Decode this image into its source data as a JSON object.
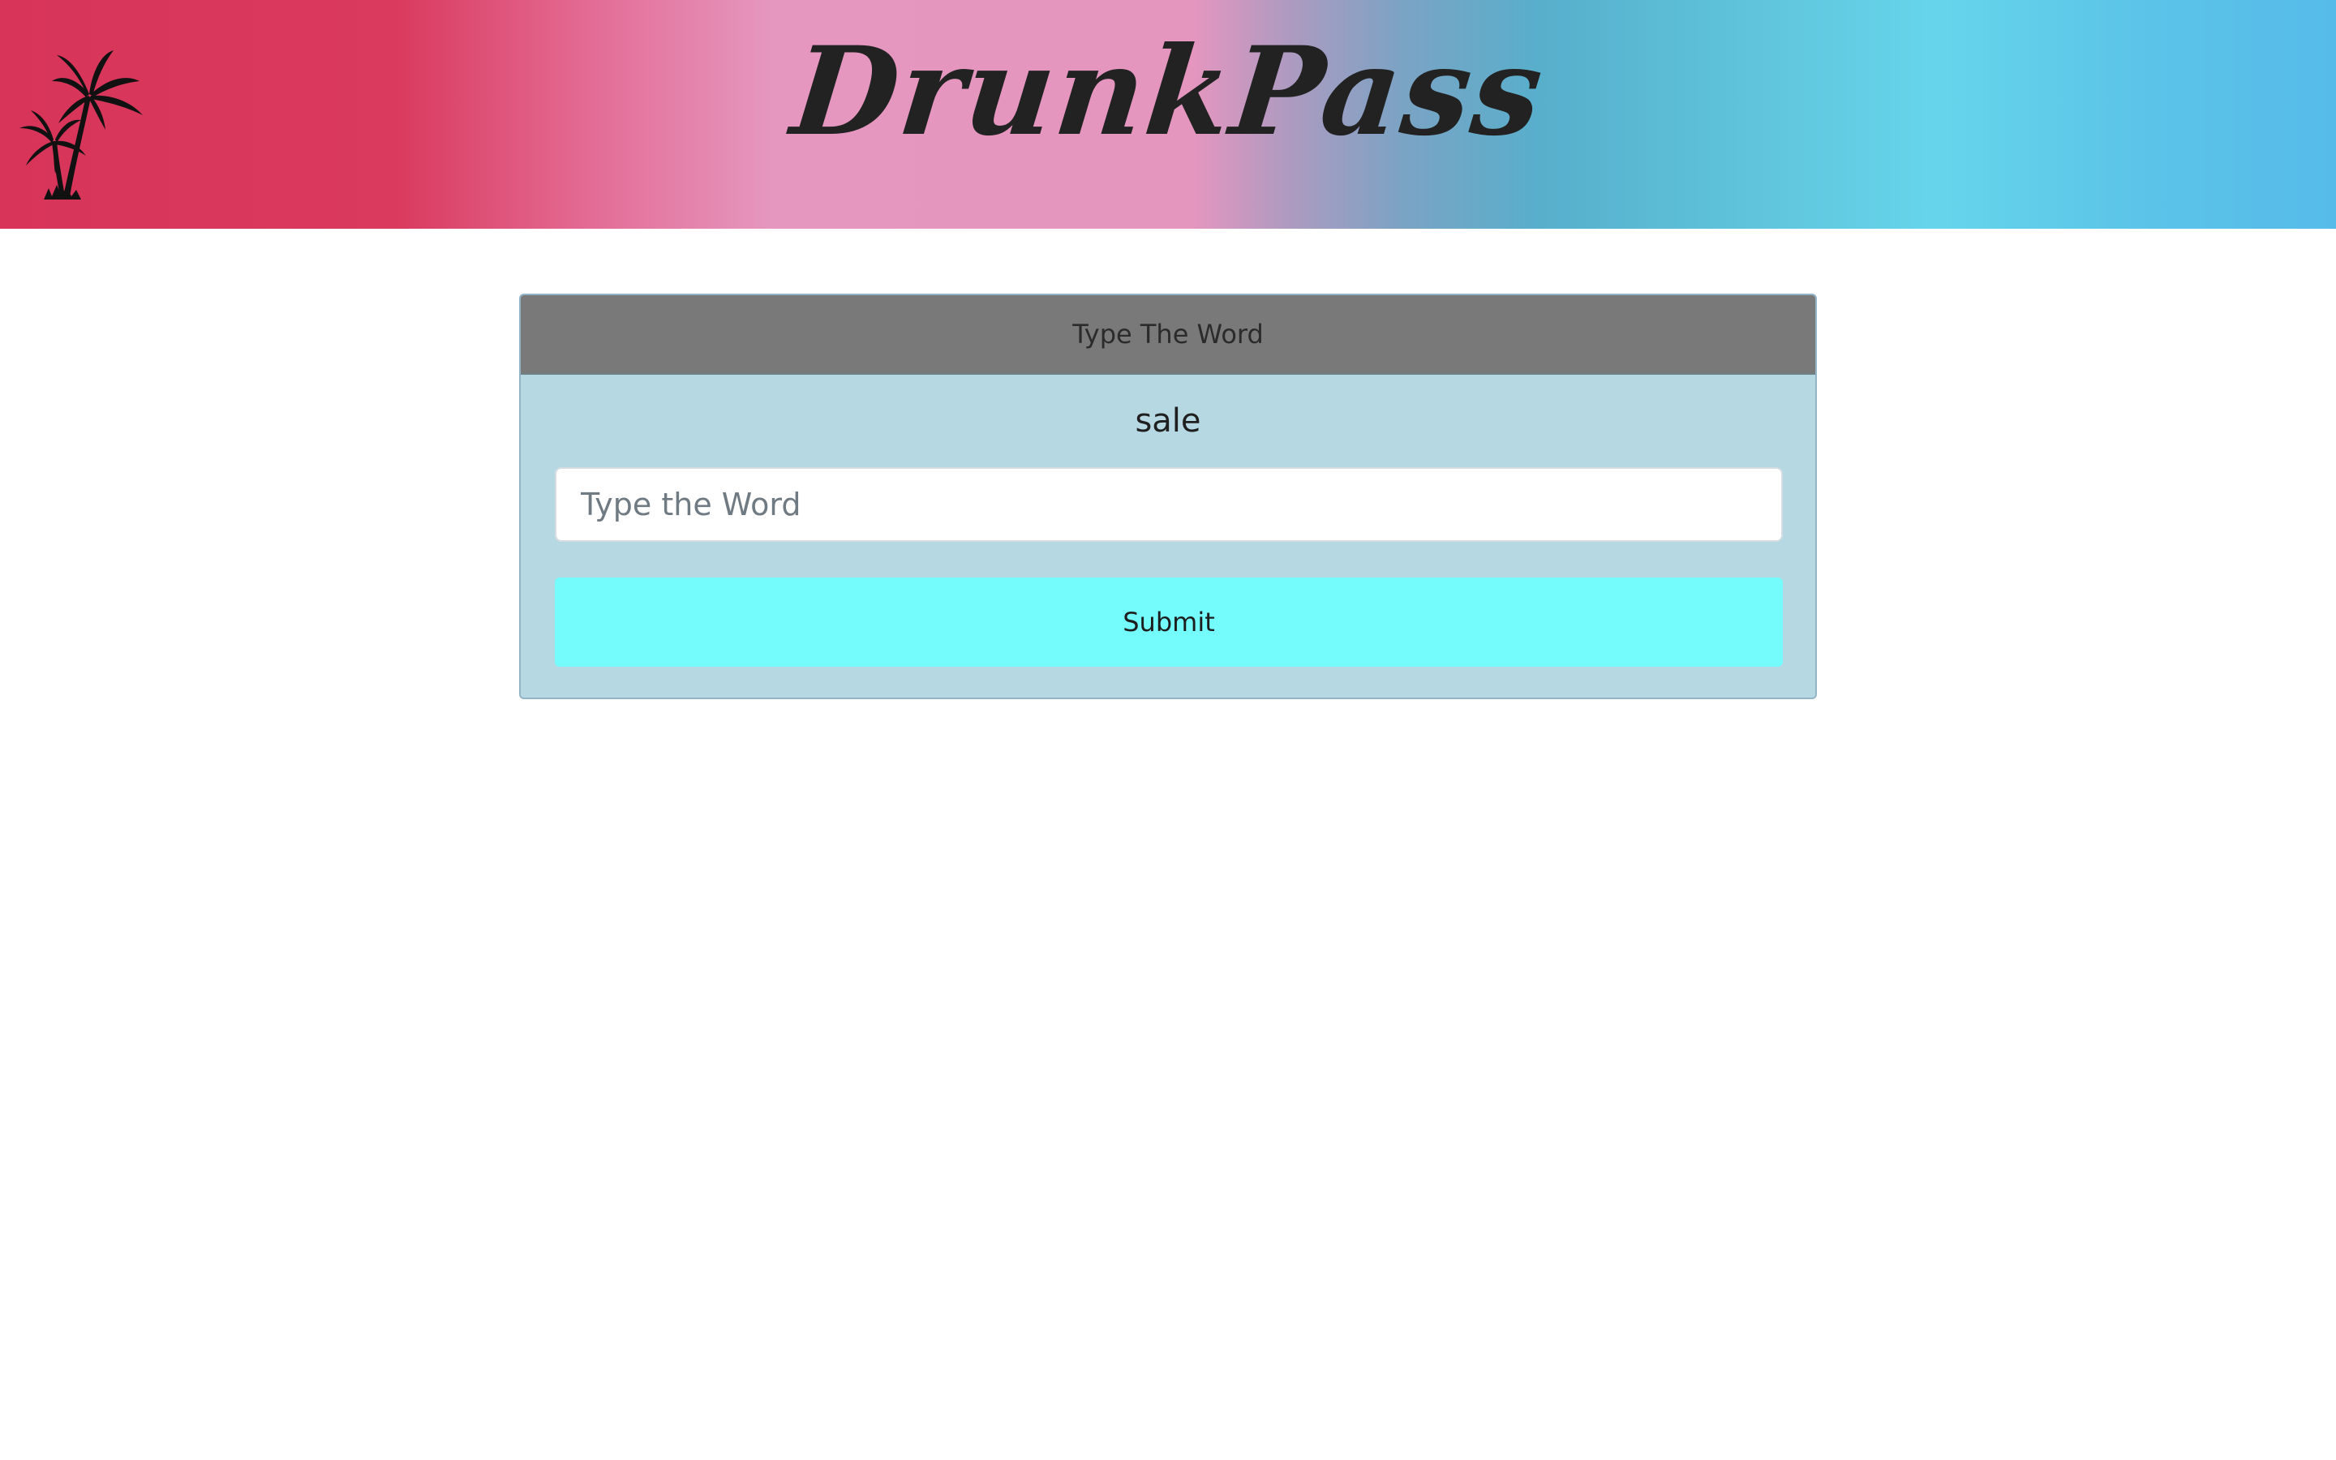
{
  "header": {
    "brand": "DrunkPass",
    "logo_icon": "palm-trees-icon"
  },
  "card": {
    "title": "Type The Word",
    "word": "sale",
    "input": {
      "value": "",
      "placeholder": "Type the Word"
    },
    "submit_label": "Submit"
  },
  "colors": {
    "banner_left": "#d8345a",
    "banner_middle": "#e596bf",
    "banner_right": "#56bbe9",
    "card_header": "#797979",
    "card_body": "#b6d8e3",
    "submit_button": "#74fcfd"
  }
}
